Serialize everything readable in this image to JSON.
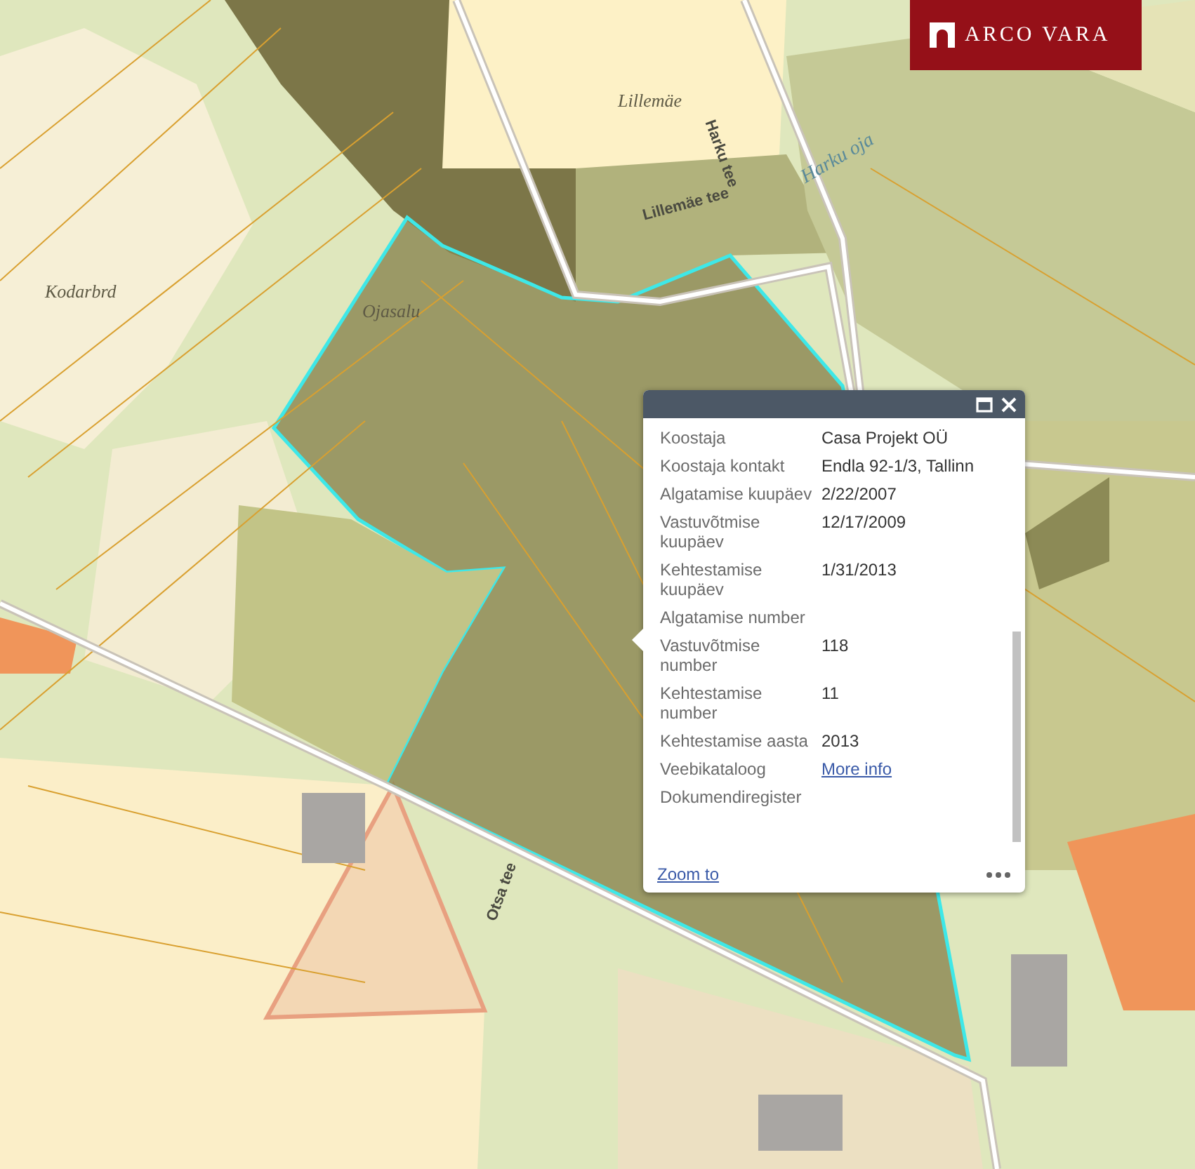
{
  "map": {
    "labels": [
      {
        "text": "Kodarbrd",
        "kind": "place"
      },
      {
        "text": "Ojasalu",
        "kind": "place"
      },
      {
        "text": "Lillemäe",
        "kind": "place"
      },
      {
        "text": "Harku tee",
        "kind": "road"
      },
      {
        "text": "Harku oja",
        "kind": "water"
      },
      {
        "text": "Lillemäe tee",
        "kind": "road"
      },
      {
        "text": "Otsa tee",
        "kind": "road"
      }
    ]
  },
  "logo": {
    "text": "ARCO VARA"
  },
  "popup": {
    "fields": [
      {
        "label": "Koostaja",
        "value": "Casa Projekt OÜ",
        "kind": "text"
      },
      {
        "label": "Koostaja kontakt",
        "value": "Endla 92-1/3, Tallinn",
        "kind": "text"
      },
      {
        "label": "Algatamise kuupäev",
        "value": "2/22/2007",
        "kind": "text"
      },
      {
        "label": "Vastuvõtmise kuupäev",
        "value": "12/17/2009",
        "kind": "text"
      },
      {
        "label": "Kehtestamise kuupäev",
        "value": "1/31/2013",
        "kind": "text"
      },
      {
        "label": "Algatamise number"
      },
      {
        "label": "Vastuvõtmise number",
        "value": "118",
        "kind": "text"
      },
      {
        "label": "Kehtestamise number",
        "value": "11",
        "kind": "text"
      },
      {
        "label": "Kehtestamise aasta",
        "value": "2013",
        "kind": "text"
      },
      {
        "label": "Veebikataloog",
        "value": "More info",
        "kind": "link"
      },
      {
        "label": "Dokumendiregister"
      }
    ],
    "zoom_link": "Zoom to"
  }
}
